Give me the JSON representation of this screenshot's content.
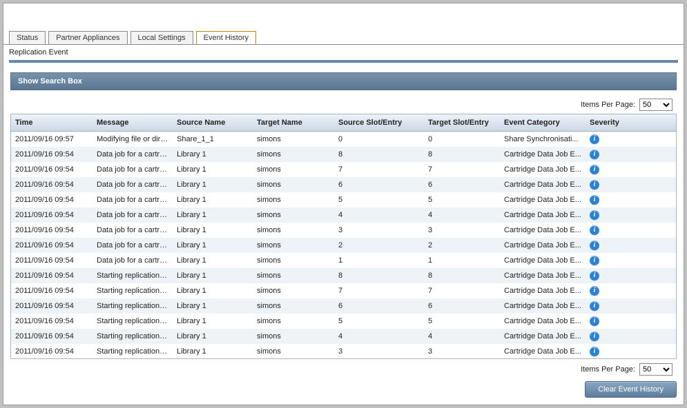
{
  "tabs": [
    {
      "label": "Status"
    },
    {
      "label": "Partner Appliances"
    },
    {
      "label": "Local Settings"
    },
    {
      "label": "Event History"
    }
  ],
  "active_tab_index": 3,
  "panel_title": "Replication Event",
  "search_bar_label": "Show Search Box",
  "items_per_page_label": "Items Per Page:",
  "items_per_page_value": "50",
  "clear_button_label": "Clear Event History",
  "columns": {
    "time": "Time",
    "message": "Message",
    "source_name": "Source Name",
    "target_name": "Target Name",
    "source_slot": "Source Slot/Entry",
    "target_slot": "Target Slot/Entry",
    "event_category": "Event Category",
    "severity": "Severity"
  },
  "rows": [
    {
      "time": "2011/09/16 09:57",
      "message": "Modifying file or dire...",
      "source": "Share_1_1",
      "target": "simons",
      "sslot": "0",
      "tslot": "0",
      "category": "Share Synchronisati..."
    },
    {
      "time": "2011/09/16 09:54",
      "message": "Data job for a cartrid...",
      "source": "Library 1",
      "target": "simons",
      "sslot": "8",
      "tslot": "8",
      "category": "Cartridge Data Job E..."
    },
    {
      "time": "2011/09/16 09:54",
      "message": "Data job for a cartrid...",
      "source": "Library 1",
      "target": "simons",
      "sslot": "7",
      "tslot": "7",
      "category": "Cartridge Data Job E..."
    },
    {
      "time": "2011/09/16 09:54",
      "message": "Data job for a cartrid...",
      "source": "Library 1",
      "target": "simons",
      "sslot": "6",
      "tslot": "6",
      "category": "Cartridge Data Job E..."
    },
    {
      "time": "2011/09/16 09:54",
      "message": "Data job for a cartrid...",
      "source": "Library 1",
      "target": "simons",
      "sslot": "5",
      "tslot": "5",
      "category": "Cartridge Data Job E..."
    },
    {
      "time": "2011/09/16 09:54",
      "message": "Data job for a cartrid...",
      "source": "Library 1",
      "target": "simons",
      "sslot": "4",
      "tslot": "4",
      "category": "Cartridge Data Job E..."
    },
    {
      "time": "2011/09/16 09:54",
      "message": "Data job for a cartrid...",
      "source": "Library 1",
      "target": "simons",
      "sslot": "3",
      "tslot": "3",
      "category": "Cartridge Data Job E..."
    },
    {
      "time": "2011/09/16 09:54",
      "message": "Data job for a cartrid...",
      "source": "Library 1",
      "target": "simons",
      "sslot": "2",
      "tslot": "2",
      "category": "Cartridge Data Job E..."
    },
    {
      "time": "2011/09/16 09:54",
      "message": "Data job for a cartrid...",
      "source": "Library 1",
      "target": "simons",
      "sslot": "1",
      "tslot": "1",
      "category": "Cartridge Data Job E..."
    },
    {
      "time": "2011/09/16 09:54",
      "message": "Starting replication of...",
      "source": "Library 1",
      "target": "simons",
      "sslot": "8",
      "tslot": "8",
      "category": "Cartridge Data Job E..."
    },
    {
      "time": "2011/09/16 09:54",
      "message": "Starting replication of...",
      "source": "Library 1",
      "target": "simons",
      "sslot": "7",
      "tslot": "7",
      "category": "Cartridge Data Job E..."
    },
    {
      "time": "2011/09/16 09:54",
      "message": "Starting replication of...",
      "source": "Library 1",
      "target": "simons",
      "sslot": "6",
      "tslot": "6",
      "category": "Cartridge Data Job E..."
    },
    {
      "time": "2011/09/16 09:54",
      "message": "Starting replication of...",
      "source": "Library 1",
      "target": "simons",
      "sslot": "5",
      "tslot": "5",
      "category": "Cartridge Data Job E..."
    },
    {
      "time": "2011/09/16 09:54",
      "message": "Starting replication of...",
      "source": "Library 1",
      "target": "simons",
      "sslot": "4",
      "tslot": "4",
      "category": "Cartridge Data Job E..."
    },
    {
      "time": "2011/09/16 09:54",
      "message": "Starting replication of...",
      "source": "Library 1",
      "target": "simons",
      "sslot": "3",
      "tslot": "3",
      "category": "Cartridge Data Job E..."
    }
  ]
}
